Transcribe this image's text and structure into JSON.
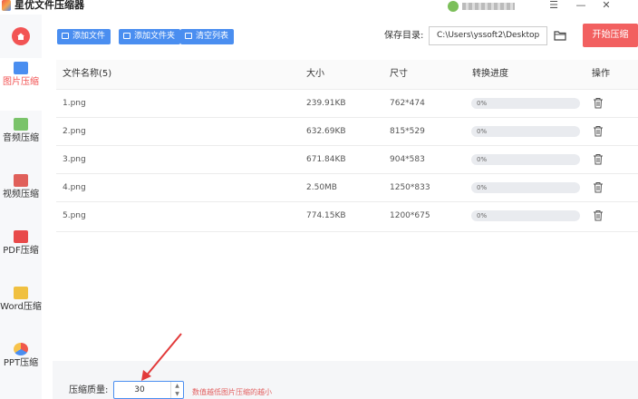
{
  "app": {
    "title": "星优文件压缩器"
  },
  "window": {
    "menu_glyph": "☰",
    "minimize_glyph": "—",
    "close_glyph": "✕"
  },
  "sidebar": {
    "home_icon": "home-icon",
    "items": [
      {
        "label": "图片压缩",
        "icon": "image-icon",
        "active": true
      },
      {
        "label": "音频压缩",
        "icon": "audio-icon"
      },
      {
        "label": "视频压缩",
        "icon": "video-icon"
      },
      {
        "label": "PDF压缩",
        "icon": "pdf-icon"
      },
      {
        "label": "Word压缩",
        "icon": "word-icon"
      },
      {
        "label": "PPT压缩",
        "icon": "ppt-icon"
      }
    ]
  },
  "toolbar": {
    "add_file": "添加文件",
    "add_folder": "添加文件夹",
    "clear_list": "清空列表",
    "save_dir_label": "保存目录:",
    "save_dir_value": "C:\\Users\\yssoft2\\Desktop",
    "start": "开始压缩"
  },
  "table": {
    "headers": [
      "文件名称(5)",
      "大小",
      "尺寸",
      "转换进度",
      "操作"
    ],
    "rows": [
      {
        "name": "1.png",
        "size": "239.91KB",
        "dim": "762*474",
        "progress": "0%"
      },
      {
        "name": "2.png",
        "size": "632.69KB",
        "dim": "815*529",
        "progress": "0%"
      },
      {
        "name": "3.png",
        "size": "671.84KB",
        "dim": "904*583",
        "progress": "0%"
      },
      {
        "name": "4.png",
        "size": "2.50MB",
        "dim": "1250*833",
        "progress": "0%"
      },
      {
        "name": "5.png",
        "size": "774.15KB",
        "dim": "1200*675",
        "progress": "0%"
      }
    ]
  },
  "settings": {
    "quality_label": "压缩质量:",
    "quality_value": "30",
    "quality_hint": "数值越低图片压缩的越小"
  },
  "colors": {
    "accent": "#4a8ef0",
    "danger": "#f25454"
  }
}
